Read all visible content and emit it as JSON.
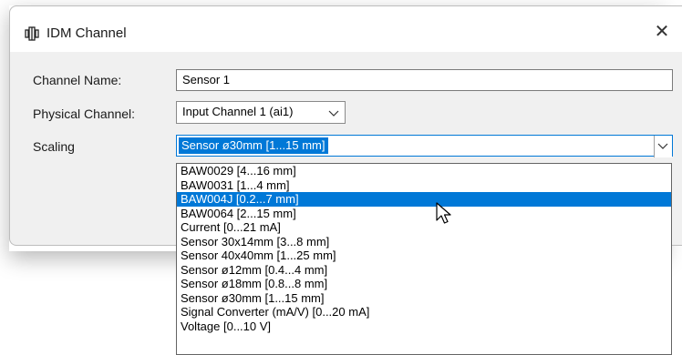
{
  "window": {
    "title": "IDM Channel",
    "close_glyph": "✕",
    "app_icon": "channel-icon"
  },
  "form": {
    "channel_name": {
      "label": "Channel Name:",
      "value": "Sensor 1"
    },
    "physical_channel": {
      "label": "Physical Channel:",
      "value": "Input Channel 1 (ai1)"
    },
    "scaling": {
      "label": "Scaling",
      "value": "Sensor ø30mm [1...15 mm]"
    }
  },
  "dropdown": {
    "highlighted_index": 2,
    "options": [
      "BAW0029 [4...16 mm]",
      "BAW0031 [1...4 mm]",
      "BAW004J [0.2...7 mm]",
      "BAW0064 [2...15 mm]",
      "Current [0...21 mA]",
      "Sensor 30x14mm [3...8 mm]",
      "Sensor 40x40mm [1...25 mm]",
      "Sensor ø12mm [0.4...4 mm]",
      "Sensor ø18mm [0.8...8 mm]",
      "Sensor ø30mm [1...15 mm]",
      "Signal Converter (mA/V) [0...20 mA]",
      "Voltage [0...10 V]"
    ]
  },
  "colors": {
    "accent": "#0078d7",
    "dialog_bg": "#f0f0f0",
    "titlebar_bg": "#ffffff"
  }
}
